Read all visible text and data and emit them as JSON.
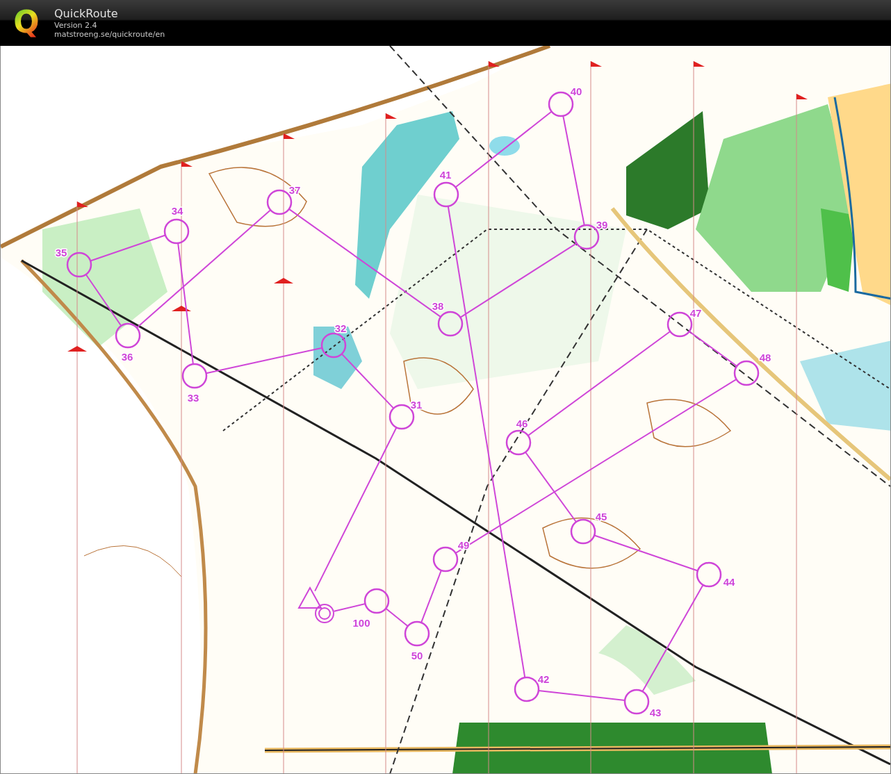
{
  "header": {
    "logo_letter": "Q",
    "title": "QuickRoute",
    "version": "Version 2.4",
    "url": "matstroeng.se/quickroute/en"
  },
  "course": {
    "controls": [
      {
        "kind": "start"
      },
      {
        "kind": "control",
        "label": "31"
      },
      {
        "kind": "control",
        "label": "32"
      },
      {
        "kind": "control",
        "label": "33"
      },
      {
        "kind": "control",
        "label": "34"
      },
      {
        "kind": "control",
        "label": "35"
      },
      {
        "kind": "control",
        "label": "36"
      },
      {
        "kind": "control",
        "label": "37"
      },
      {
        "kind": "control",
        "label": "38"
      },
      {
        "kind": "control",
        "label": "39"
      },
      {
        "kind": "control",
        "label": "40"
      },
      {
        "kind": "control",
        "label": "41"
      },
      {
        "kind": "control",
        "label": "42"
      },
      {
        "kind": "control",
        "label": "43"
      },
      {
        "kind": "control",
        "label": "44"
      },
      {
        "kind": "control",
        "label": "45"
      },
      {
        "kind": "control",
        "label": "46"
      },
      {
        "kind": "control",
        "label": "47"
      },
      {
        "kind": "control",
        "label": "48"
      },
      {
        "kind": "control",
        "label": "49"
      },
      {
        "kind": "control",
        "label": "50"
      },
      {
        "kind": "control",
        "label": "100"
      },
      {
        "kind": "finish"
      }
    ]
  }
}
